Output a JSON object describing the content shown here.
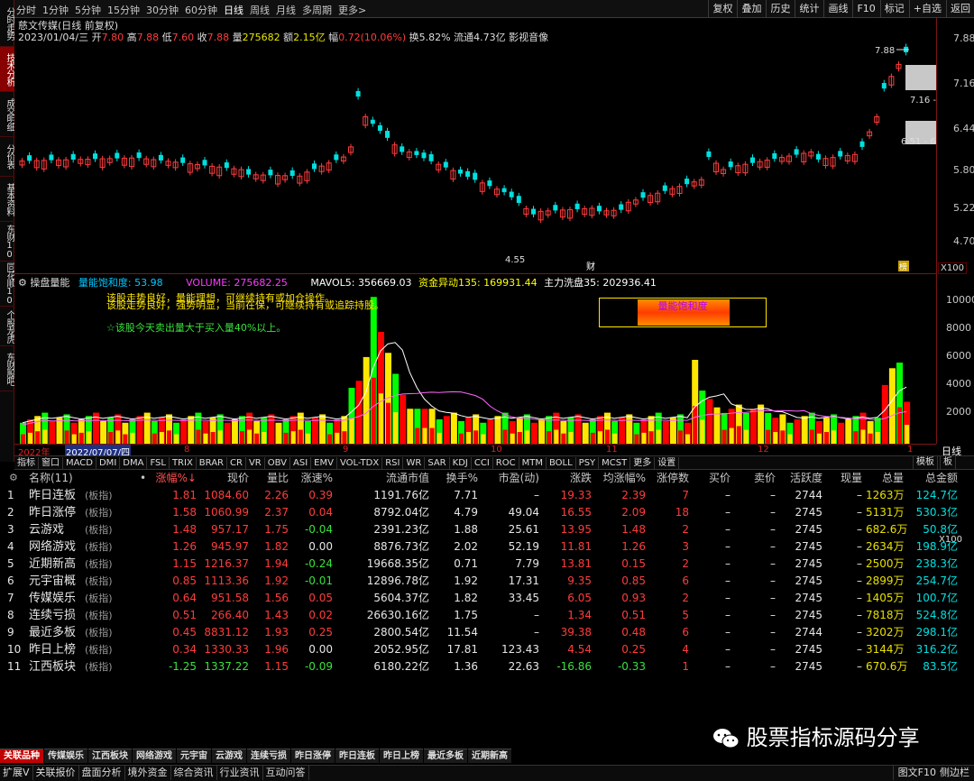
{
  "top_menu": {
    "periods": [
      "分时",
      "1分钟",
      "5分钟",
      "15分钟",
      "30分钟",
      "60分钟",
      "日线",
      "周线",
      "月线",
      "多周期",
      "更多>"
    ],
    "active_period": "日线",
    "tools": [
      "复权",
      "叠加",
      "历史",
      "统计",
      "画线",
      "F10",
      "标记",
      "+自选",
      "返回"
    ]
  },
  "left_tabs": [
    "分时走势",
    "技术分析",
    "成交明细",
    "分价表",
    "基本资料",
    "东财10",
    "同花顺10",
    "个股龙虎",
    "东财股吧"
  ],
  "active_left_tab": "技术分析",
  "stock": {
    "title": "慈文传媒(日线 前复权)",
    "date": "2023/01/04/三",
    "open_label": "开",
    "open": "7.80",
    "high_label": "高",
    "high": "7.88",
    "low_label": "低",
    "low": "7.60",
    "close_label": "收",
    "close": "7.88",
    "vol_label": "量",
    "volume": "275682",
    "amount_label": "额",
    "amount": "2.15亿",
    "chg_label": "幅",
    "change": "0.72(10.06%)",
    "turnover": "换5.82%",
    "float": "流通4.73亿",
    "media": "影视音像"
  },
  "price_axis": [
    "7.88",
    "7.16",
    "6.44",
    "5.80",
    "5.22",
    "4.70"
  ],
  "price_marks": {
    "peak": "7.88",
    "low": "4.55",
    "box_upper": "7.16 -",
    "box_lower": "6.51 - 6.",
    "badge_cai": "财",
    "badge_bang": "榜",
    "xscale": "X100"
  },
  "indicator": {
    "name": "操盘量能",
    "subtitle": "量能饱和度: 53.98",
    "volume_label": "VOLUME: 275682.25",
    "mavol": "MAVOL5: 356669.03",
    "fund": "资金异动135: 169931.44",
    "main": "主力洗盘35: 202936.41",
    "text1": "该股走势良好，量能理想，可继续持有或加仓操作。",
    "text1b": "该股走势良好，强势明显，当前在保，可继续持有或追踪持股。",
    "text2": "☆该股今天卖出量大于买入量40%以上。",
    "box_label": "量能饱和度",
    "yaxis": [
      "10000",
      "8000",
      "6000",
      "4000",
      "2000"
    ],
    "xscale": "X100"
  },
  "x_axis": {
    "year": "2022年",
    "date": "2022/07/07/四",
    "months": [
      "8",
      "9",
      "10",
      "11",
      "12",
      "1"
    ],
    "period_btn": "日线"
  },
  "indicator_tabs": [
    "指标",
    "窗口",
    "MACD",
    "DMI",
    "DMA",
    "FSL",
    "TRIX",
    "BRAR",
    "CR",
    "VR",
    "OBV",
    "ASI",
    "EMV",
    "VOL-TDX",
    "RSI",
    "WR",
    "SAR",
    "KDJ",
    "CCI",
    "ROC",
    "MTM",
    "BOLL",
    "PSY",
    "MCST",
    "更多",
    "设置"
  ],
  "indicator_right": [
    "模板",
    "板"
  ],
  "table": {
    "headers": [
      "名称(11)",
      "•",
      "涨幅%↓",
      "现价",
      "量比",
      "涨速%",
      "流通市值",
      "换手%",
      "市盈(动)",
      "涨跌",
      "均涨幅%",
      "涨停数",
      "买价",
      "卖价",
      "活跃度",
      "现量",
      "总量",
      "总金额"
    ],
    "rows": [
      [
        "1",
        "昨日连板",
        "(板指)",
        "1.81",
        "1084.60",
        "2.26",
        "0.39",
        "1191.76亿",
        "7.71",
        "–",
        "19.33",
        "2.39",
        "7",
        "–",
        "–",
        "2744",
        "–",
        "1263万",
        "124.7亿"
      ],
      [
        "2",
        "昨日涨停",
        "(板指)",
        "1.58",
        "1060.99",
        "2.37",
        "0.04",
        "8792.04亿",
        "4.79",
        "49.04",
        "16.55",
        "2.09",
        "18",
        "–",
        "–",
        "2745",
        "–",
        "5131万",
        "530.3亿"
      ],
      [
        "3",
        "云游戏",
        "(板指)",
        "1.48",
        "957.17",
        "1.75",
        "-0.04",
        "2391.23亿",
        "1.88",
        "25.61",
        "13.95",
        "1.48",
        "2",
        "–",
        "–",
        "2745",
        "–",
        "682.6万",
        "50.8亿"
      ],
      [
        "4",
        "网络游戏",
        "(板指)",
        "1.26",
        "945.97",
        "1.82",
        "0.00",
        "8876.73亿",
        "2.02",
        "52.19",
        "11.81",
        "1.26",
        "3",
        "–",
        "–",
        "2745",
        "–",
        "2634万",
        "198.9亿"
      ],
      [
        "5",
        "近期新高",
        "(板指)",
        "1.15",
        "1216.37",
        "1.94",
        "-0.24",
        "19668.35亿",
        "0.71",
        "7.79",
        "13.81",
        "0.15",
        "2",
        "–",
        "–",
        "2745",
        "–",
        "2500万",
        "238.3亿"
      ],
      [
        "6",
        "元宇宙概",
        "(板指)",
        "0.85",
        "1113.36",
        "1.92",
        "-0.01",
        "12896.78亿",
        "1.92",
        "17.31",
        "9.35",
        "0.85",
        "6",
        "–",
        "–",
        "2745",
        "–",
        "2899万",
        "254.7亿"
      ],
      [
        "7",
        "传媒娱乐",
        "(板指)",
        "0.64",
        "951.58",
        "1.56",
        "0.05",
        "5604.37亿",
        "1.82",
        "33.45",
        "6.05",
        "0.93",
        "2",
        "–",
        "–",
        "2745",
        "–",
        "1405万",
        "100.7亿"
      ],
      [
        "8",
        "连续亏损",
        "(板指)",
        "0.51",
        "266.40",
        "1.43",
        "0.02",
        "26630.16亿",
        "1.75",
        "–",
        "1.34",
        "0.51",
        "5",
        "–",
        "–",
        "2745",
        "–",
        "7818万",
        "524.8亿"
      ],
      [
        "9",
        "最近多板",
        "(板指)",
        "0.45",
        "8831.12",
        "1.93",
        "0.25",
        "2800.54亿",
        "11.54",
        "–",
        "39.38",
        "0.48",
        "6",
        "–",
        "–",
        "2744",
        "–",
        "3202万",
        "298.1亿"
      ],
      [
        "10",
        "昨日上榜",
        "(板指)",
        "0.34",
        "1330.33",
        "1.96",
        "0.00",
        "2052.95亿",
        "17.81",
        "123.43",
        "4.54",
        "0.25",
        "4",
        "–",
        "–",
        "2745",
        "–",
        "3144万",
        "316.2亿"
      ],
      [
        "11",
        "江西板块",
        "(板指)",
        "-1.25",
        "1337.22",
        "1.15",
        "-0.09",
        "6180.22亿",
        "1.36",
        "22.63",
        "-16.86",
        "-0.33",
        "1",
        "–",
        "–",
        "2745",
        "–",
        "670.6万",
        "83.5亿"
      ]
    ]
  },
  "bottom_tabs": [
    "关联品种",
    "传媒娱乐",
    "江西板块",
    "网络游戏",
    "元宇宙",
    "云游戏",
    "连续亏损",
    "昨日涨停",
    "昨日连板",
    "昨日上榜",
    "最近多板",
    "近期新高"
  ],
  "status_bar": [
    "扩展V",
    "关联报价",
    "盘面分析",
    "境外资金",
    "综合资讯",
    "行业资讯",
    "互动问答"
  ],
  "status_right": [
    "图文F10",
    "侧边栏"
  ],
  "watermark": "股票指标源码分享",
  "colors": {
    "up": "#ff3c3c",
    "down": "#00e0e0",
    "vol_up": "#ff0000",
    "vol_down": "#00ff00",
    "vol_yellow": "#ffe600"
  }
}
